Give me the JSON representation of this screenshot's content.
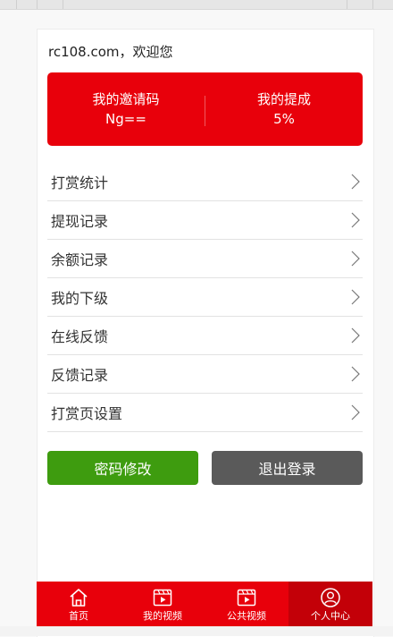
{
  "greeting": "rc108.com，欢迎您",
  "stats": {
    "invite_label": "我的邀请码",
    "invite_value": "Ng==",
    "commission_label": "我的提成",
    "commission_value": "5%"
  },
  "menu": [
    {
      "label": "打赏统计"
    },
    {
      "label": "提现记录"
    },
    {
      "label": "余额记录"
    },
    {
      "label": "我的下级"
    },
    {
      "label": "在线反馈"
    },
    {
      "label": "反馈记录"
    },
    {
      "label": "打赏页设置"
    }
  ],
  "buttons": {
    "change_password": "密码修改",
    "logout": "退出登录"
  },
  "tabbar": [
    {
      "label": "首页",
      "icon": "home-icon",
      "active": false
    },
    {
      "label": "我的视频",
      "icon": "video-icon",
      "active": false
    },
    {
      "label": "公共视频",
      "icon": "video-icon",
      "active": false
    },
    {
      "label": "个人中心",
      "icon": "user-icon",
      "active": true
    }
  ],
  "colors": {
    "brand_red": "#e8000b",
    "active_tab": "#c30008",
    "green_button": "#3e9c0f",
    "gray_button": "#5a5a5a"
  }
}
